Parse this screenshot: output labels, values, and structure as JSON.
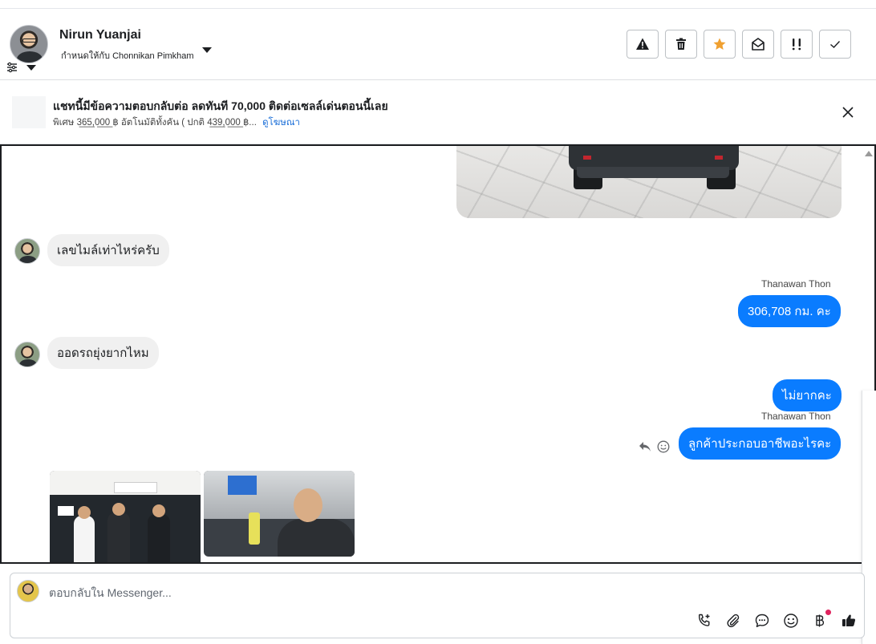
{
  "header": {
    "name": "Nirun Yuanjai",
    "assigned_prefix": "กำหนดให้กับ",
    "assigned_to": "Chonnikan Pimkham",
    "actions": [
      "spam",
      "delete",
      "star",
      "mark-unread",
      "important",
      "done"
    ]
  },
  "ad_banner": {
    "title": "แชทนี้มีข้อความตอบกลับต่อ ลดทันที 70,000 ติดต่อเซลล์เด่นตอนนี้เลย",
    "subtitle": "พิเศษ 3̲6̲5̲,0̲0̲0̲ ฿ อัตโนมัติทั้งคัน ( ปกติ 4̲3̲9̲,0̲0̲0̲ ฿...",
    "link_text": "ดูโฆษณา"
  },
  "messages": {
    "in1": "เลขไมล์เท่าไหร่ครับ",
    "sender1": "Thanawan Thon",
    "out1": "306,708 กม. คะ",
    "in2": "ออดรถยุ่งยากไหม",
    "out2": "ไม่ยากคะ",
    "sender2": "Thanawan Thon",
    "out3": "ลูกค้าประกอบอาชีพอะไรคะ"
  },
  "composer": {
    "placeholder": "ตอบกลับใน Messenger..."
  },
  "colors": {
    "outgoing_bubble": "#0a7cff",
    "incoming_bubble": "#f0f0f0",
    "star": "#f0a030",
    "link": "#1a6ed8"
  }
}
